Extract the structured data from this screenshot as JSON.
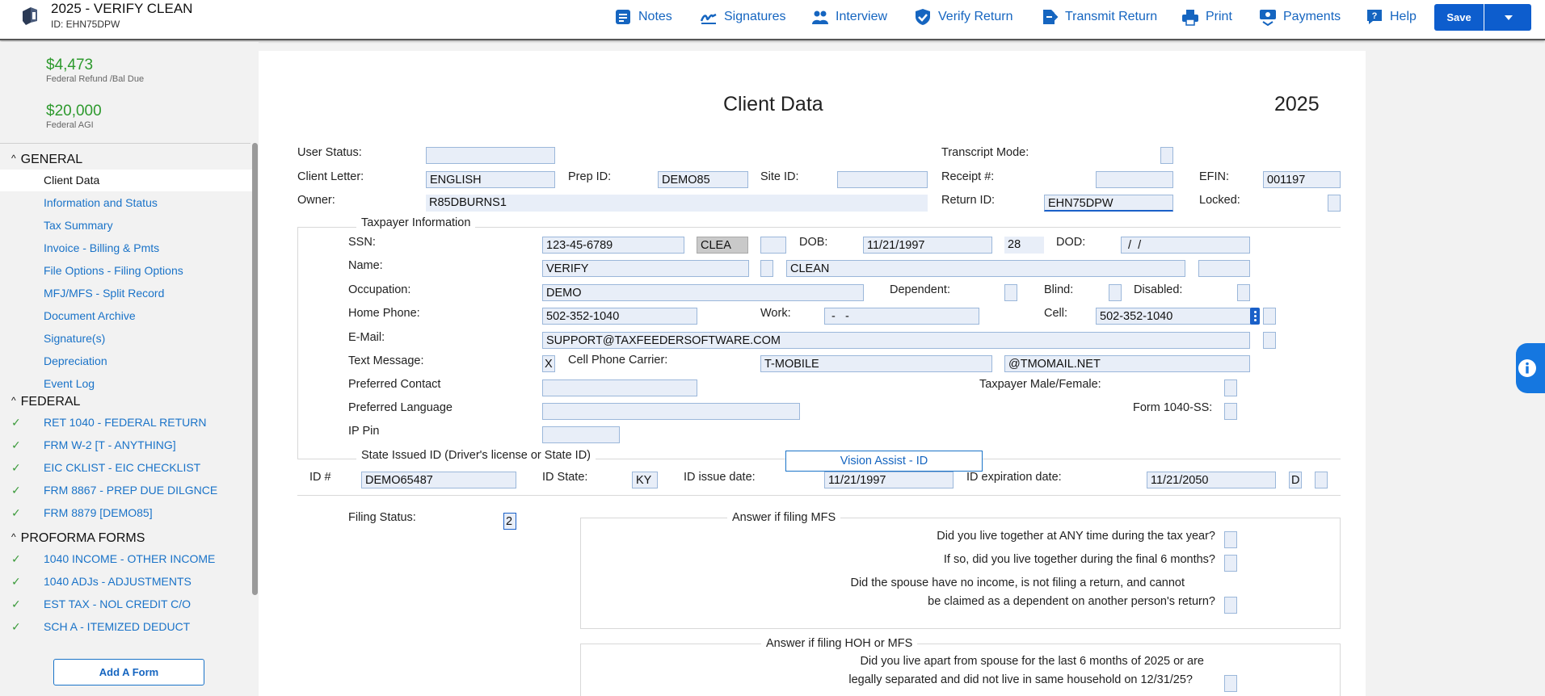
{
  "header": {
    "title": "2025 - VERIFY CLEAN",
    "id_text": "ID: EHN75DPW",
    "nav": [
      {
        "label": "Notes",
        "icon": "notes-icon"
      },
      {
        "label": "Signatures",
        "icon": "signature-icon"
      },
      {
        "label": "Interview",
        "icon": "interview-icon"
      },
      {
        "label": "Verify Return",
        "icon": "shield-check-icon"
      },
      {
        "label": "Transmit Return",
        "icon": "transmit-icon"
      },
      {
        "label": "Print",
        "icon": "printer-icon"
      },
      {
        "label": "Payments",
        "icon": "payments-icon"
      },
      {
        "label": "Help",
        "icon": "help-icon"
      }
    ],
    "save_label": "Save"
  },
  "sidebar": {
    "refund_amount": "$4,473",
    "refund_label": "Federal Refund /Bal Due",
    "agi_amount": "$20,000",
    "agi_label": "Federal AGI",
    "sections": [
      {
        "title": "GENERAL",
        "items": [
          "Client Data",
          "Information and Status",
          "Tax Summary",
          "Invoice - Billing & Pmts",
          "File Options - Filing Options",
          "MFJ/MFS - Split Record",
          "Document Archive",
          "Signature(s)",
          "Depreciation",
          "Event Log"
        ]
      },
      {
        "title": "FEDERAL",
        "items": [
          "RET 1040 - FEDERAL RETURN",
          "FRM W-2 [T - ANYTHING]",
          "EIC CKLIST - EIC CHECKLIST",
          "FRM 8867 - PREP DUE DILGNCE",
          "FRM 8879 [DEMO85]"
        ]
      },
      {
        "title": "PROFORMA FORMS",
        "items": [
          "1040 INCOME - OTHER INCOME",
          "1040 ADJs - ADJUSTMENTS",
          "EST TAX - NOL CREDIT C/O",
          "SCH A - ITEMIZED DEDUCT"
        ]
      }
    ],
    "add_form_label": "Add A Form"
  },
  "form": {
    "title": "Client Data",
    "year": "2025",
    "labels": {
      "user_status": "User Status:",
      "client_letter": "Client Letter:",
      "prep_id": "Prep ID:",
      "site_id": "Site ID:",
      "owner": "Owner:",
      "transcript_mode": "Transcript Mode:",
      "receipt": "Receipt #:",
      "efin": "EFIN:",
      "return_id": "Return ID:",
      "locked": "Locked:"
    },
    "values": {
      "client_letter": "ENGLISH",
      "prep_id": "DEMO85",
      "owner": "R85DBURNS1",
      "efin": "001197",
      "return_id": "EHN75DPW"
    },
    "taxpayer": {
      "title": "Taxpayer Information",
      "labels": {
        "ssn": "SSN:",
        "dob": "DOB:",
        "dod": "DOD:",
        "name": "Name:",
        "occupation": "Occupation:",
        "dependent": "Dependent:",
        "blind": "Blind:",
        "disabled": "Disabled:",
        "home_phone": "Home Phone:",
        "work": "Work:",
        "cell": "Cell:",
        "email": "E-Mail:",
        "text_message": "Text Message:",
        "carrier": "Cell Phone Carrier:",
        "preferred_contact": "Preferred Contact",
        "male_female": "Taxpayer Male/Female:",
        "preferred_language": "Preferred Language",
        "form_1040ss": "Form 1040-SS:",
        "ip_pin": "IP Pin"
      },
      "values": {
        "ssn": "123-45-6789",
        "name_control": "CLEA",
        "dob": "11/21/1997",
        "age": "28",
        "dod": " /  /",
        "first_name": "VERIFY",
        "last_name": "CLEAN",
        "occupation": "DEMO",
        "home_phone": "502-352-1040",
        "work": " -   -",
        "cell": "502-352-1040",
        "email": "SUPPORT@TAXFEEDERSOFTWARE.COM",
        "text_message": "X",
        "carrier": "T-MOBILE",
        "carrier_domain": "@TMOMAIL.NET"
      }
    },
    "state_id": {
      "title": "State Issued ID (Driver's license or State ID)",
      "vision_button": "Vision Assist - ID",
      "labels": {
        "id_num": "ID #",
        "id_state": "ID State:",
        "issue_date": "ID issue date:",
        "expiration_date": "ID expiration date:"
      },
      "values": {
        "id_num": "DEMO65487",
        "id_state": "KY",
        "issue_date": "11/21/1997",
        "expiration_date": "11/21/2050",
        "exp_code": "D"
      }
    },
    "filing": {
      "label": "Filing Status:",
      "value": "2",
      "mfs_title": "Answer if filing MFS",
      "mfs_questions": [
        "Did you live together at ANY time during the tax year?",
        "If so, did you live together during the final 6 months?",
        "Did the spouse have no income, is not filing a return, and cannot",
        "be claimed as a dependent on another person's return?"
      ],
      "hoh_title": "Answer if filing HOH or MFS",
      "hoh_questions": [
        "Did you live apart from spouse for the last 6 months of 2025 or are",
        "legally separated and did not live in same household on 12/31/25?"
      ]
    }
  },
  "colors": {
    "accent": "#1565c0",
    "save": "#0d5dcd",
    "money": "#2e9a2e",
    "field": "#e8eef8"
  }
}
